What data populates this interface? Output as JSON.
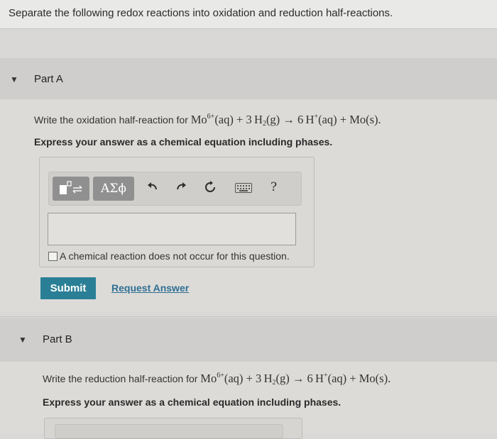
{
  "intro": {
    "text": "Separate the following redox reactions into oxidation and reduction half-reactions."
  },
  "part_a": {
    "label": "Part A",
    "question_prefix": "Write the oxidation half-reaction for",
    "reaction": {
      "reactant1": "Mo",
      "reactant1_charge": "6+",
      "state_aq": "(aq)",
      "plus": "+",
      "coef_h2": "3",
      "h2_base": "H",
      "h2_sub": "2",
      "state_g": "(g)",
      "arrow": "→",
      "coef_h": "6",
      "h_base": "H",
      "h_charge": "+",
      "product2": "Mo(s)",
      "period": "."
    },
    "instruction": "Express your answer as a chemical equation including phases.",
    "toolbar": {
      "greek_label": "ΑΣϕ",
      "help_label": "?"
    },
    "input_value": "",
    "no_reaction_label": "A chemical reaction does not occur for this question.",
    "submit_label": "Submit",
    "request_label": "Request Answer"
  },
  "part_b": {
    "label": "Part B",
    "question_prefix": "Write the reduction half-reaction for",
    "instruction": "Express your answer as a chemical equation including phases."
  },
  "colors": {
    "submit_bg": "#2a7f96",
    "link": "#2f6f93"
  }
}
